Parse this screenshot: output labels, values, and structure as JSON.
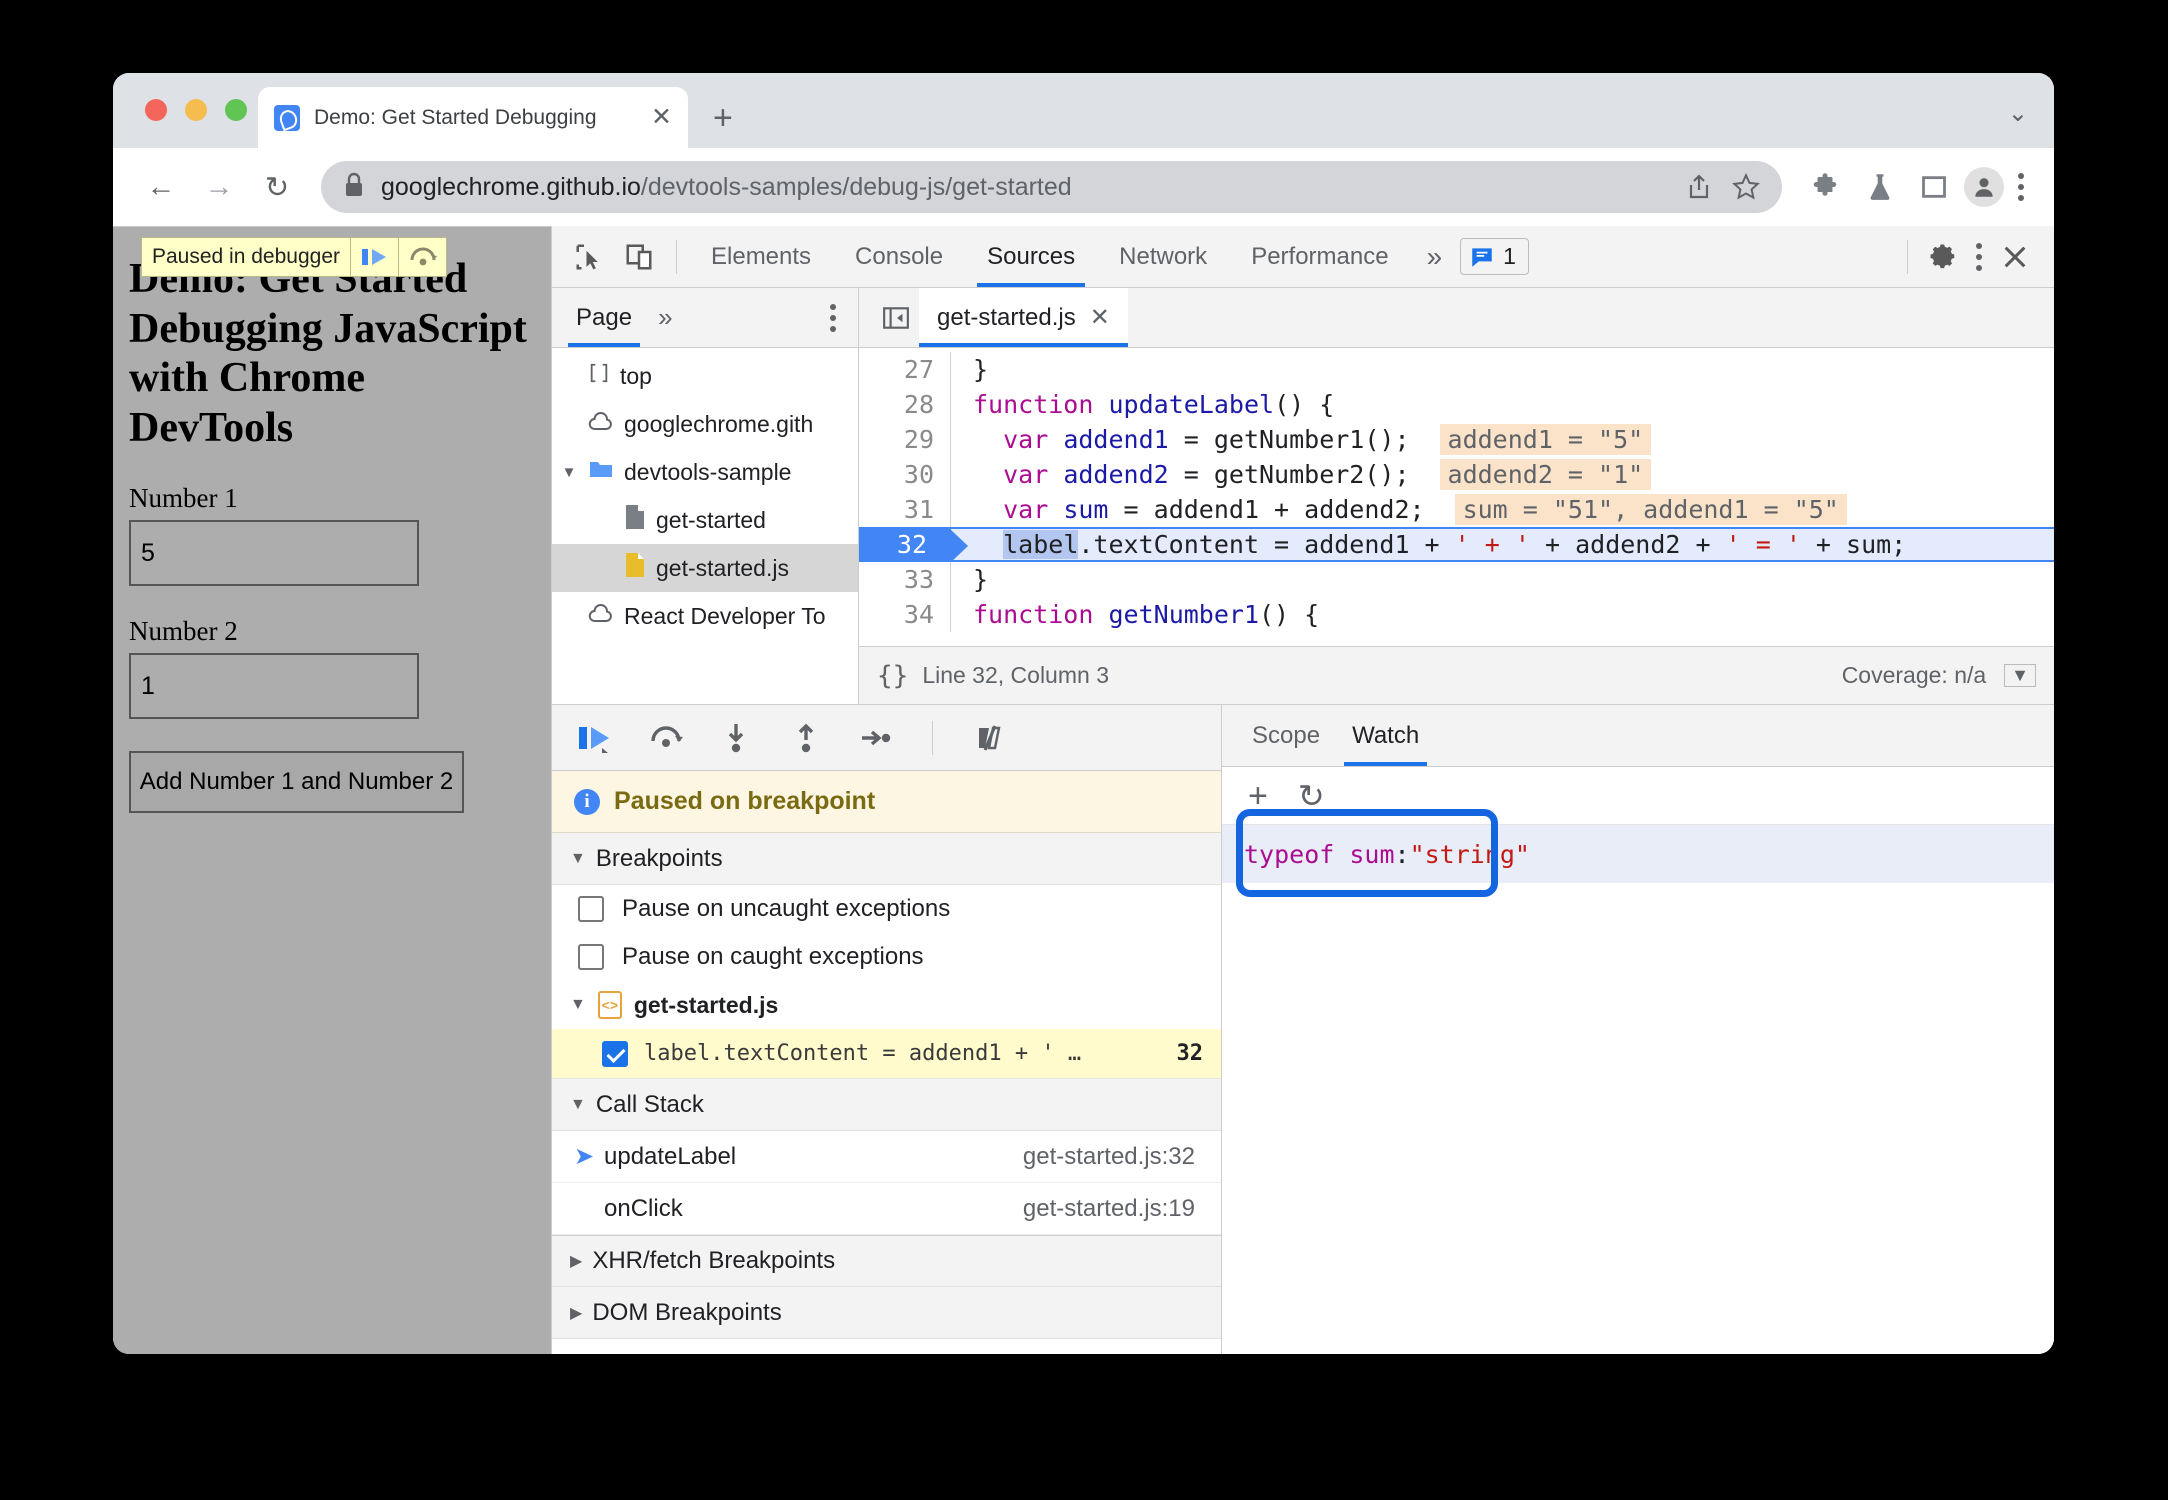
{
  "browser": {
    "tab": {
      "title": "Demo: Get Started Debugging",
      "close_label": "✕"
    },
    "new_tab_label": "+",
    "collapse_label": "⌄",
    "back_label": "←",
    "forward_label": "→",
    "reload_label": "↻",
    "url_secure": "googlechrome.github.io",
    "url_path": "/devtools-samples/debug-js/get-started",
    "icons": [
      "lock-icon",
      "share-icon",
      "star-icon",
      "extensions-icon",
      "flask-icon",
      "sidepanel-icon",
      "profile-icon",
      "browser-menu-icon"
    ]
  },
  "page": {
    "paused_chip": {
      "label": "Paused in debugger",
      "resume": "resume-icon",
      "step_over": "step-over-icon"
    },
    "heading": "Demo: Get Started Debugging JavaScript with Chrome DevTools",
    "fields": [
      {
        "label": "Number 1",
        "value": "5"
      },
      {
        "label": "Number 2",
        "value": "1"
      }
    ],
    "button_label": "Add Number 1 and Number 2"
  },
  "devtools": {
    "tabs": [
      {
        "label": "Elements",
        "active": false
      },
      {
        "label": "Console",
        "active": false
      },
      {
        "label": "Sources",
        "active": true
      },
      {
        "label": "Network",
        "active": false
      },
      {
        "label": "Performance",
        "active": false
      }
    ],
    "overflow_label": "»",
    "issues_count": "1",
    "right_icons": [
      "settings-gear-icon",
      "devtools-menu-icon",
      "close-devtools-icon"
    ],
    "left_icons": [
      "inspect-element-icon",
      "device-toolbar-icon"
    ]
  },
  "navigator": {
    "tab_label": "Page",
    "overflow_label": "»",
    "tree": [
      {
        "label": "top",
        "icon": "frame-icon",
        "indent": 0,
        "twisty": "",
        "selected": false
      },
      {
        "label": "googlechrome.gith",
        "icon": "cloud-icon",
        "indent": 0,
        "twisty": "",
        "selected": false
      },
      {
        "label": "devtools-sample",
        "icon": "folder-icon",
        "indent": 0,
        "twisty": "▼",
        "selected": false
      },
      {
        "label": "get-started",
        "icon": "doc-icon",
        "indent": 1,
        "twisty": "",
        "selected": false
      },
      {
        "label": "get-started.js",
        "icon": "js-doc-icon",
        "indent": 1,
        "twisty": "",
        "selected": true
      },
      {
        "label": "React Developer To",
        "icon": "cloud-icon",
        "indent": 0,
        "twisty": "",
        "selected": false
      }
    ]
  },
  "editor": {
    "tab_label": "get-started.js",
    "tab_close": "✕",
    "panel_toggle_icon": "show-navigator-icon",
    "status": {
      "format_icon": "{}",
      "position": "Line 32, Column 3",
      "coverage": "Coverage: n/a",
      "drawer_icon": "▼"
    },
    "lines": [
      {
        "num": "27",
        "current": false,
        "text": "}",
        "inline": ""
      },
      {
        "num": "28",
        "current": false,
        "text": "function updateLabel() {",
        "inline": ""
      },
      {
        "num": "29",
        "current": false,
        "text": "  var addend1 = getNumber1();",
        "inline": "addend1 = \"5\""
      },
      {
        "num": "30",
        "current": false,
        "text": "  var addend2 = getNumber2();",
        "inline": "addend2 = \"1\""
      },
      {
        "num": "31",
        "current": false,
        "text": "  var sum = addend1 + addend2;",
        "inline": "sum = \"51\", addend1 = \"5\""
      },
      {
        "num": "32",
        "current": true,
        "text": "  label.textContent = addend1 + ' + ' + addend2 + ' = ' + sum;",
        "inline": ""
      },
      {
        "num": "33",
        "current": false,
        "text": "}",
        "inline": ""
      },
      {
        "num": "34",
        "current": false,
        "text": "function getNumber1() {",
        "inline": ""
      }
    ]
  },
  "debugger": {
    "toolbar_icons": [
      "resume-script-icon",
      "step-over-icon",
      "step-into-icon",
      "step-out-icon",
      "step-icon",
      "deactivate-breakpoints-icon"
    ],
    "paused_banner": "Paused on breakpoint",
    "breakpoints_header": "Breakpoints",
    "pause_uncaught": "Pause on uncaught exceptions",
    "pause_caught": "Pause on caught exceptions",
    "bp_file": "get-started.js",
    "bp_snippet": "label.textContent = addend1 + ' …",
    "bp_line": "32",
    "callstack_header": "Call Stack",
    "callstack": [
      {
        "fn": "updateLabel",
        "loc": "get-started.js:32",
        "active": true
      },
      {
        "fn": "onClick",
        "loc": "get-started.js:19",
        "active": false
      }
    ],
    "xhr_header": "XHR/fetch Breakpoints",
    "dom_header": "DOM Breakpoints"
  },
  "watch": {
    "tabs": [
      {
        "label": "Scope",
        "active": false
      },
      {
        "label": "Watch",
        "active": true
      }
    ],
    "add_label": "+",
    "refresh_label": "↻",
    "expression": "typeof sum",
    "separator": ": ",
    "value": "\"string\""
  },
  "colors": {
    "accent": "#1a73e8",
    "highlight_ring": "#1565e0",
    "inline_value_bg": "#fbe3ca",
    "breakpoint_row_bg": "#fffbcc",
    "paused_banner_bg": "#fdf6e3"
  }
}
